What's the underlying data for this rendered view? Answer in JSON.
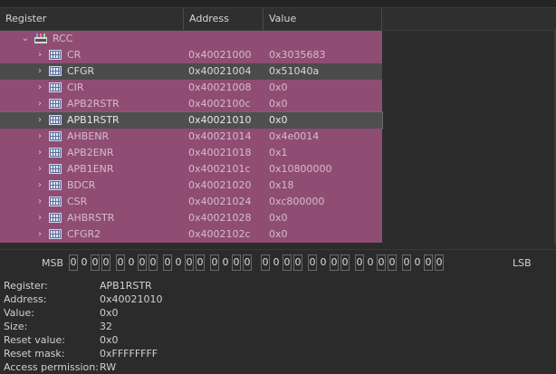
{
  "header": {
    "col_register": "Register",
    "col_address": "Address",
    "col_value": "Value"
  },
  "tree": {
    "root": {
      "name": "RCC",
      "icon": "peripheral-icon"
    },
    "registers": [
      {
        "name": "CR",
        "address": "0x40021000",
        "value": "0x3035683"
      },
      {
        "name": "CFGR",
        "address": "0x40021004",
        "value": "0x51040a"
      },
      {
        "name": "CIR",
        "address": "0x40021008",
        "value": "0x0"
      },
      {
        "name": "APB2RSTR",
        "address": "0x4002100c",
        "value": "0x0"
      },
      {
        "name": "APB1RSTR",
        "address": "0x40021010",
        "value": "0x0"
      },
      {
        "name": "AHBENR",
        "address": "0x40021014",
        "value": "0x4e0014"
      },
      {
        "name": "APB2ENR",
        "address": "0x40021018",
        "value": "0x1"
      },
      {
        "name": "APB1ENR",
        "address": "0x4002101c",
        "value": "0x10800000"
      },
      {
        "name": "BDCR",
        "address": "0x40021020",
        "value": "0x18"
      },
      {
        "name": "CSR",
        "address": "0x40021024",
        "value": "0xc800000"
      },
      {
        "name": "AHBRSTR",
        "address": "0x40021028",
        "value": "0x0"
      },
      {
        "name": "CFGR2",
        "address": "0x4002102c",
        "value": "0x0"
      }
    ],
    "selected": "APB1RSTR"
  },
  "bits": {
    "msb_label": "MSB",
    "lsb_label": "LSB",
    "values": [
      "0",
      "0",
      "0",
      "0",
      "0",
      "0",
      "0",
      "0",
      "0",
      "0",
      "0",
      "0",
      "0",
      "0",
      "0",
      "0",
      "0",
      "0",
      "0",
      "0",
      "0",
      "0",
      "0",
      "0",
      "0",
      "0",
      "0",
      "0",
      "0",
      "0",
      "0",
      "0"
    ]
  },
  "details": {
    "rows": [
      {
        "key": "Register:",
        "value": "APB1RSTR"
      },
      {
        "key": "Address:",
        "value": "0x40021010"
      },
      {
        "key": "Value:",
        "value": "0x0"
      },
      {
        "key": "Size:",
        "value": "32"
      },
      {
        "key": "Reset value:",
        "value": "0x0"
      },
      {
        "key": "Reset mask:",
        "value": "0xFFFFFFFF"
      },
      {
        "key": "Access permission:",
        "value": "RW"
      }
    ]
  },
  "colors": {
    "row_bg": "#8f4d73",
    "row_alt_bg": "#4b4b4b",
    "selected_bg": "#4f4f4f"
  }
}
